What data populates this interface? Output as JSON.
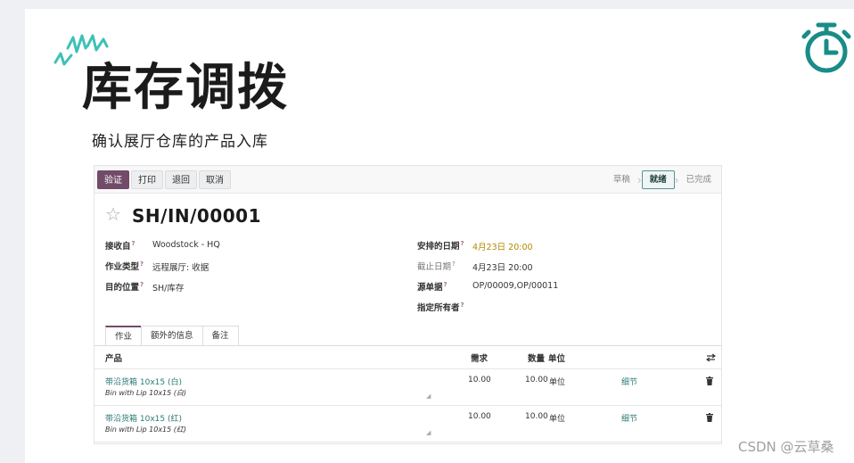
{
  "slide": {
    "title": "库存调拨",
    "subtitle": "确认展厅仓库的产品入库",
    "watermark": "CSDN @云草桑"
  },
  "toolbar": {
    "buttons": [
      "验证",
      "打印",
      "退回",
      "取消"
    ]
  },
  "status": {
    "steps": [
      "草稿",
      "就绪",
      "已完成"
    ],
    "active": "就绪"
  },
  "record": {
    "reference": "SH/IN/00001",
    "fields_left": [
      {
        "label": "接收自",
        "value": "Woodstock - HQ",
        "help": "?"
      },
      {
        "label": "作业类型",
        "value": "远程展厅: 收据",
        "help": "?"
      },
      {
        "label": "目的位置",
        "value": "SH/库存",
        "help": "?"
      }
    ],
    "fields_right": [
      {
        "label": "安排的日期",
        "value": "4月23日 20:00",
        "help": "?"
      },
      {
        "label": "截止日期",
        "value": "4月23日 20:00",
        "help": "?"
      },
      {
        "label": "源单据",
        "value": "OP/00009,OP/00011",
        "help": "?"
      },
      {
        "label": "指定所有者",
        "value": "",
        "help": "?"
      }
    ]
  },
  "tabs": [
    "作业",
    "额外的信息",
    "备注"
  ],
  "table": {
    "headers": {
      "product": "产品",
      "demand": "需求",
      "quantity": "数量",
      "unit": "单位"
    },
    "rows": [
      {
        "product": "带沿货箱 10x15 (白)",
        "description": "Bin with Lip 10x15 (白)",
        "demand": "10.00",
        "quantity": "10.00",
        "unit": "单位",
        "detail": "细节"
      },
      {
        "product": "带沿货箱 10x15 (红)",
        "description": "Bin with Lip 10x15 (红)",
        "demand": "10.00",
        "quantity": "10.00",
        "unit": "单位",
        "detail": "细节"
      }
    ]
  },
  "icons": {
    "spark": "spark-icon",
    "stopwatch": "stopwatch-icon",
    "star": "star-icon",
    "settings": "column-settings-icon",
    "delete": "trash-icon"
  },
  "colors": {
    "primary": "#714b67",
    "accent_teal": "#1a8c87",
    "spark_teal": "#3fc0b6",
    "date_yellow": "#b48800"
  }
}
